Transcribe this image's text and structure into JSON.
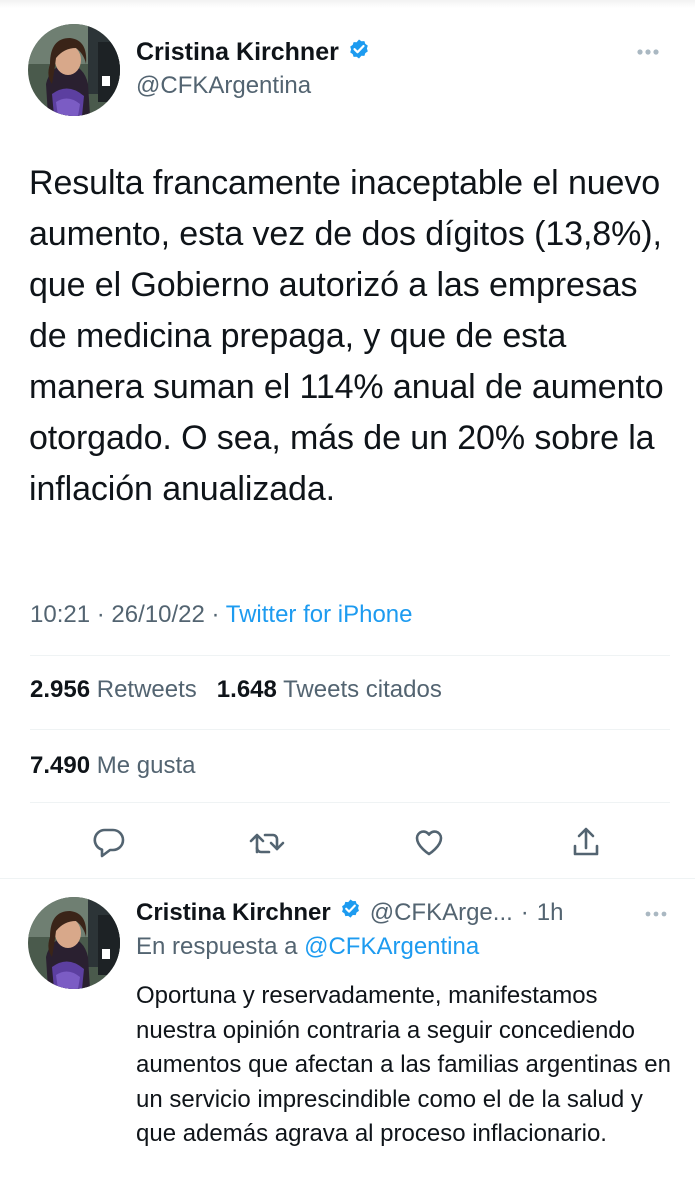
{
  "main_tweet": {
    "author_name": "Cristina Kirchner",
    "handle": "@CFKArgentina",
    "verified_icon": "verified-badge-icon",
    "text": "Resulta francamente inaceptable el nuevo aumento, esta vez de dos dígitos (13,8%), que el Gobierno autorizó a las empresas de medicina prepaga, y que de esta manera suman el 114% anual de aumento otorgado. O sea, más de un 20% sobre la inflación anualizada.",
    "time": "10:21",
    "date": "26/10/22",
    "separator": "·",
    "source": "Twitter for iPhone",
    "retweets_count": "2.956",
    "retweets_label": "Retweets",
    "quotes_count": "1.648",
    "quotes_label": "Tweets citados",
    "likes_count": "7.490",
    "likes_label": "Me gusta"
  },
  "actions": {
    "reply_icon": "reply-icon",
    "retweet_icon": "retweet-icon",
    "like_icon": "like-icon",
    "share_icon": "share-icon"
  },
  "reply_tweet": {
    "author_name": "Cristina Kirchner",
    "handle": "@CFKArge...",
    "separator": "·",
    "time_ago": "1h",
    "in_reply_prefix": "En respuesta a",
    "in_reply_mention": "@CFKArgentina",
    "text": "Oportuna y reservadamente, manifestamos nuestra opinión contraria a seguir concediendo aumentos que afectan a las familias argentinas en un servicio imprescindible como el de la salud y que además agrava al proceso inflacionario."
  },
  "colors": {
    "accent": "#1d9bf0",
    "secondary_text": "#536471",
    "primary_text": "#0f1419",
    "divider": "#eff3f4"
  }
}
